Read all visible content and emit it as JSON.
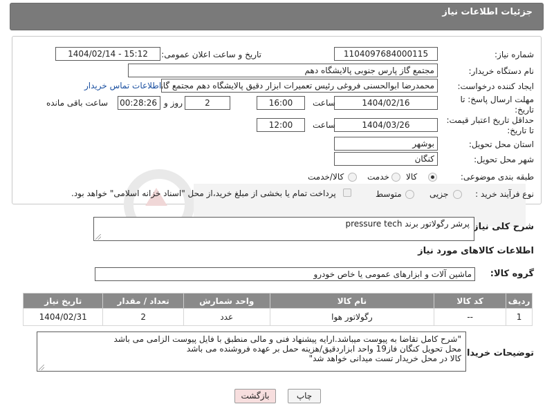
{
  "header": {
    "title": "جزئیات اطلاعات نیاز"
  },
  "form": {
    "need_number_label": "شماره نیاز:",
    "need_number": "1104097684000115",
    "announce_label": "تاریخ و ساعت اعلان عمومی:",
    "announce_value": "1404/02/14 - 15:12",
    "buyer_org_label": "نام دستگاه خریدار:",
    "buyer_org": "مجتمع گاز پارس جنوبی  پالایشگاه دهم",
    "requester_label": "ایجاد کننده درخواست:",
    "requester": "محمدرضا ابوالحسنی فروغی رئیس تعمیرات ابزار دقیق پالایشگاه دهم  مجتمع گاز پارس جنوبی",
    "contact_link": "اطلاعات تماس خریدار",
    "deadline_label_1": "مهلت ارسال پاسخ: تا",
    "deadline_label_2": "تاریخ:",
    "deadline_date": "1404/02/16",
    "time_label": "ساعت",
    "deadline_time": "16:00",
    "days_value": "2",
    "days_label": "روز و",
    "remaining_time": "00:28:26",
    "remaining_label": "ساعت باقی مانده",
    "validity_label_1": "حداقل تاریخ اعتبار قیمت:",
    "validity_label_2": "تا تاریخ:",
    "validity_date": "1404/03/26",
    "validity_time": "12:00",
    "province_label": "استان محل تحویل:",
    "province": "بوشهر",
    "city_label": "شهر محل تحویل:",
    "city": "کنگان",
    "category_label": "طبقه بندی موضوعی:",
    "category_options": [
      "کالا",
      "خدمت",
      "کالا/خدمت"
    ],
    "process_label": "نوع فرآیند خرید :",
    "process_options": [
      "جزیی",
      "متوسط"
    ],
    "payment_note": "پرداخت تمام یا بخشی از مبلغ خرید،از محل \"اسناد خزانه اسلامی\" خواهد بود."
  },
  "description": {
    "label": "شرح کلی نیاز:",
    "value": "پرشر رگولاتور برند pressure tech"
  },
  "goods": {
    "section_title": "اطلاعات کالاهای مورد نیاز",
    "group_label": "گروه کالا:",
    "group_value": "ماشین آلات و ابزارهای عمومی یا خاص خودرو"
  },
  "table": {
    "headers": [
      "ردیف",
      "کد کالا",
      "نام کالا",
      "واحد شمارش",
      "تعداد / مقدار",
      "تاریخ نیاز"
    ],
    "rows": [
      [
        "1",
        "--",
        "رگولاتور هوا",
        "عدد",
        "2",
        "1404/02/31"
      ]
    ]
  },
  "buyer_notes": {
    "label": "توضیحات خریدار:",
    "lines": [
      "\"شرح کامل تقاضا به پیوست میباشد.ارایه پیشنهاد فنی و مالی منطبق با فایل پیوست الزامی می باشد",
      "محل تحویل کنگان فاز19 واحد ابزاردقیق/هزینه حمل بر عهده فروشنده می باشد",
      "کالا در محل خریدار تست میدانی خواهد شد\""
    ]
  },
  "buttons": {
    "print": "چاپ",
    "back": "بازگشت"
  },
  "colors": {
    "header_bg": "#7a7a7a",
    "link": "#1a4fa0",
    "back_btn_bg": "#f7dede"
  }
}
